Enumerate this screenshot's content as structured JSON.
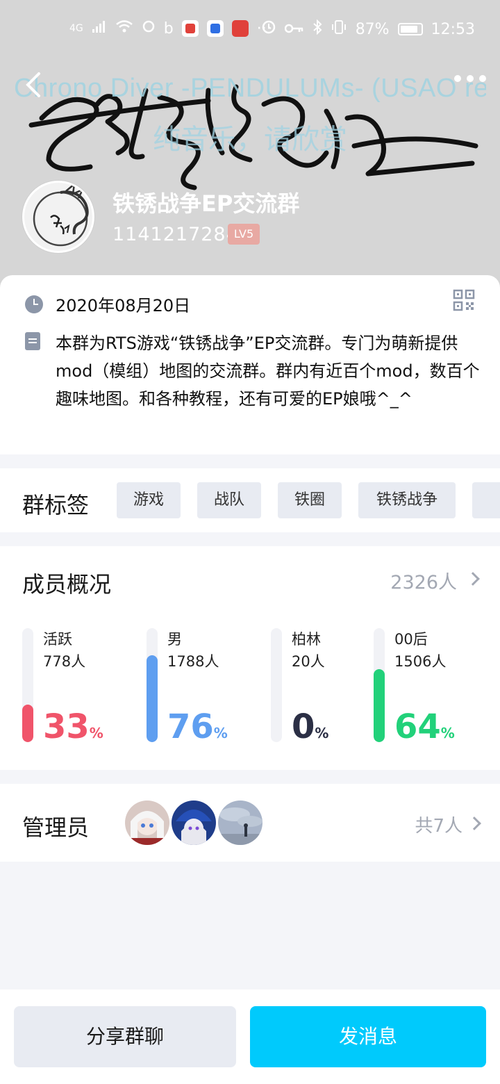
{
  "status_bar": {
    "network": "4G",
    "battery": "87%",
    "time": "12:53"
  },
  "banner": {
    "music_title": "Chrono Diver -PENDULUMs- (USAO re",
    "music_subtitle": "纯音乐，请欣赏"
  },
  "group": {
    "name": "铁锈战争EP交流群",
    "id": "1141217284",
    "level": "LV5"
  },
  "info": {
    "date": "2020年08月20日",
    "description": "本群为RTS游戏“铁锈战争”EP交流群。专门为萌新提供mod（模组）地图的交流群。群内有近百个mod，数百个趣味地图。和各种教程，还有可爱的EP娘哦^_^"
  },
  "tags": {
    "title": "群标签",
    "items": [
      "游戏",
      "战队",
      "铁圈",
      "铁锈战争"
    ]
  },
  "members": {
    "title": "成员概况",
    "total": "2326人",
    "stats": [
      {
        "label": "活跃",
        "count": "778人",
        "percent": "33",
        "pct_sign": "%",
        "fraction": 0.33,
        "color": "#f0546a"
      },
      {
        "label": "男",
        "count": "1788人",
        "percent": "76",
        "pct_sign": "%",
        "fraction": 0.76,
        "color": "#5e9ef0"
      },
      {
        "label": "柏林",
        "count": "20人",
        "percent": "0",
        "pct_sign": "%",
        "fraction": 0.0,
        "color": "#2b2f45"
      },
      {
        "label": "00后",
        "count": "1506人",
        "percent": "64",
        "pct_sign": "%",
        "fraction": 0.64,
        "color": "#22d17a"
      }
    ]
  },
  "admins": {
    "title": "管理员",
    "count": "共7人"
  },
  "actions": {
    "share": "分享群聊",
    "send": "发消息"
  }
}
